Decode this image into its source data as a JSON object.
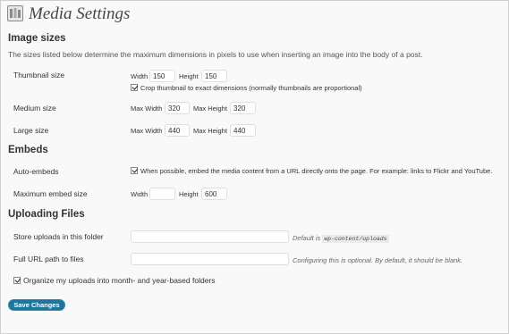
{
  "page": {
    "title": "Media Settings"
  },
  "image_sizes": {
    "heading": "Image sizes",
    "description": "The sizes listed below determine the maximum dimensions in pixels to use when inserting an image into the body of a post.",
    "thumbnail": {
      "label": "Thumbnail size",
      "width_label": "Width",
      "width_value": "150",
      "height_label": "Height",
      "height_value": "150",
      "crop_checked": true,
      "crop_label": "Crop thumbnail to exact dimensions (normally thumbnails are proportional)"
    },
    "medium": {
      "label": "Medium size",
      "max_width_label": "Max Width",
      "max_width_value": "320",
      "max_height_label": "Max Height",
      "max_height_value": "320"
    },
    "large": {
      "label": "Large size",
      "max_width_label": "Max Width",
      "max_width_value": "440",
      "max_height_label": "Max Height",
      "max_height_value": "440"
    }
  },
  "embeds": {
    "heading": "Embeds",
    "auto": {
      "label": "Auto-embeds",
      "checked": true,
      "text": "When possible, embed the media content from a URL directly onto the page. For example: links to Flickr and YouTube."
    },
    "max": {
      "label": "Maximum embed size",
      "width_label": "Width",
      "width_value": "",
      "height_label": "Height",
      "height_value": "600"
    }
  },
  "uploading": {
    "heading": "Uploading Files",
    "store": {
      "label": "Store uploads in this folder",
      "value": "",
      "note_prefix": "Default is",
      "note_code": "wp-content/uploads"
    },
    "url": {
      "label": "Full URL path to files",
      "value": "",
      "note": "Configuring this is optional. By default, it should be blank."
    },
    "organize": {
      "checked": true,
      "label": "Organize my uploads into month- and year-based folders"
    }
  },
  "save_button": {
    "label": "Save Changes"
  },
  "colors": {
    "button_bg": "#21759b",
    "page_bg": "#f9f9f9"
  }
}
